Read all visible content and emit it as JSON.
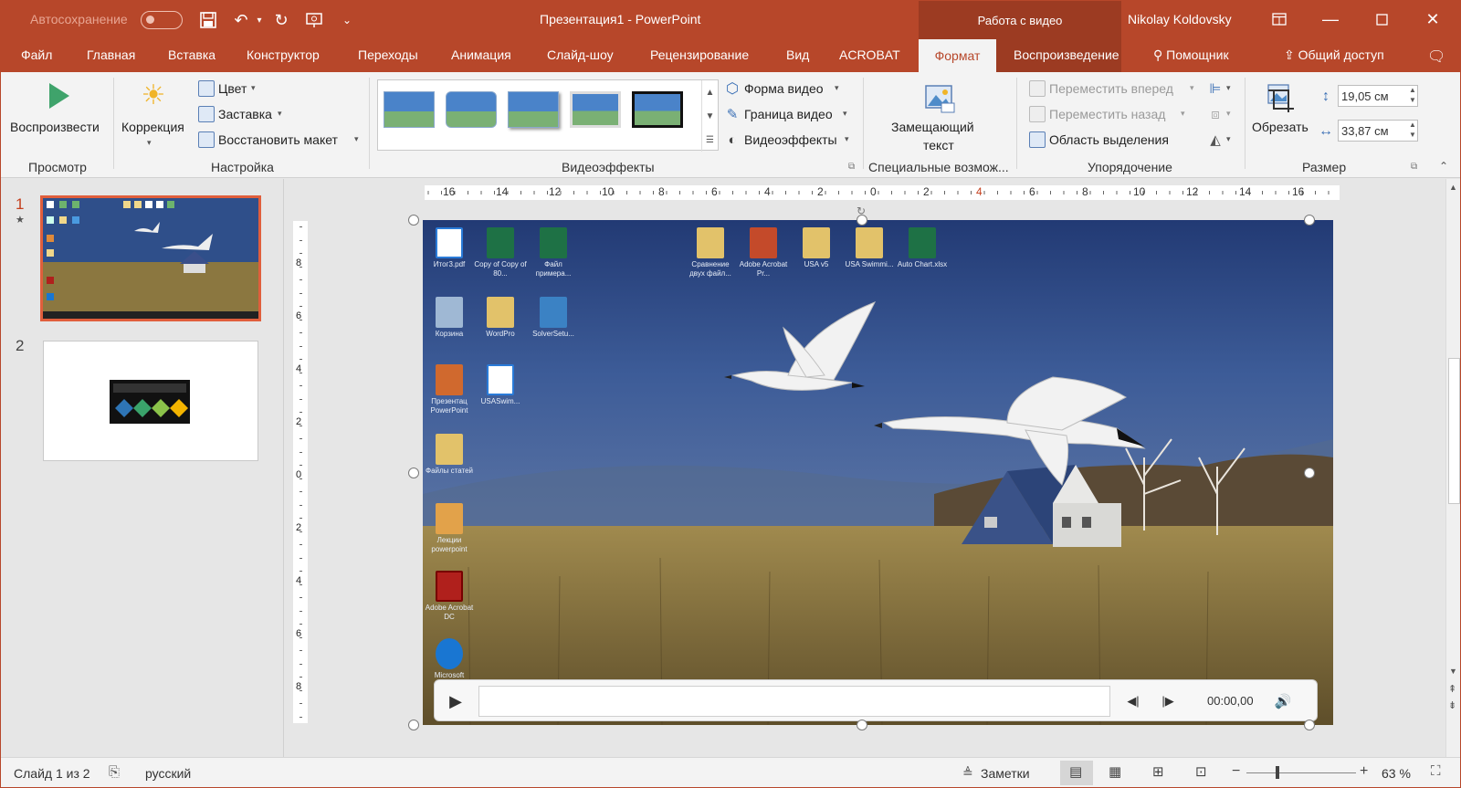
{
  "titlebar": {
    "autosave_label": "Автосохранение",
    "title": "Презентация1 - PowerPoint",
    "context_group": "Работа с видео",
    "user": "Nikolay Koldovsky"
  },
  "tabs": [
    "Файл",
    "Главная",
    "Вставка",
    "Конструктор",
    "Переходы",
    "Анимация",
    "Слайд-шоу",
    "Рецензирование",
    "Вид",
    "ACROBAT",
    "Формат",
    "Воспроизведение"
  ],
  "active_tab": "Формат",
  "tell_me": "Помощник",
  "share": "Общий доступ",
  "ribbon": {
    "preview": {
      "play": "Воспроизвести",
      "group": "Просмотр"
    },
    "adjust": {
      "correction": "Коррекция",
      "color": "Цвет",
      "poster": "Заставка",
      "reset": "Восстановить макет",
      "group": "Настройка"
    },
    "styles": {
      "shape": "Форма видео",
      "border": "Граница видео",
      "effects": "Видеоэффекты",
      "group": "Видеоэффекты"
    },
    "access": {
      "alt_line1": "Замещающий",
      "alt_line2": "текст",
      "group": "Специальные возмож..."
    },
    "arrange": {
      "forward": "Переместить вперед",
      "backward": "Переместить назад",
      "selection": "Область выделения",
      "group": "Упорядочение"
    },
    "size": {
      "crop": "Обрезать",
      "height": "19,05 см",
      "width": "33,87 см",
      "group": "Размер"
    }
  },
  "ruler_labels": [
    "16",
    "14",
    "12",
    "10",
    "8",
    "6",
    "4",
    "2",
    "0",
    "2",
    "4",
    "6",
    "8",
    "10",
    "12",
    "14",
    "16"
  ],
  "vruler_labels": [
    "8",
    "6",
    "4",
    "2",
    "0",
    "2",
    "4",
    "6",
    "8"
  ],
  "slides": [
    {
      "number": "1",
      "star": "★"
    },
    {
      "number": "2"
    }
  ],
  "desktop_icons": [
    {
      "label": "Итог3.pdf",
      "color": "#2a7bd8"
    },
    {
      "label": "Copy of Copy of 80...",
      "color": "#1e7145"
    },
    {
      "label": "Файл примера...",
      "color": "#1e7145"
    },
    {
      "label": "Сравнение двух файл...",
      "color": "#e2c26a"
    },
    {
      "label": "Adobe Acrobat Pr...",
      "color": "#c44a2a"
    },
    {
      "label": "USA v5",
      "color": "#e2c26a"
    },
    {
      "label": "USA Swimmi...",
      "color": "#e2c26a"
    },
    {
      "label": "Auto Chart.xlsx",
      "color": "#1e7145"
    },
    {
      "label": "Корзина",
      "color": "#9fb8d4"
    },
    {
      "label": "WordPro",
      "color": "#e2c26a"
    },
    {
      "label": "SolverSetu...",
      "color": "#3b82c4"
    },
    {
      "label": "Презентац PowerPoint",
      "color": "#d0692e"
    },
    {
      "label": "USASwim...",
      "color": "#2a7bd8"
    },
    {
      "label": "Файлы статей",
      "color": "#e2c26a"
    },
    {
      "label": "Лекции powerpoint",
      "color": "#e2a24a"
    },
    {
      "label": "Adobe Acrobat DC",
      "color": "#b0201c"
    },
    {
      "label": "Microsoft",
      "color": "#1976d2"
    }
  ],
  "player": {
    "time": "00:00,00"
  },
  "status": {
    "slide": "Слайд 1 из 2",
    "language": "русский",
    "notes": "Заметки",
    "zoom": "63 %"
  },
  "colors": {
    "accent": "#b7472a",
    "context": "#9c3b22",
    "selected_slide": "#e05e3c"
  }
}
